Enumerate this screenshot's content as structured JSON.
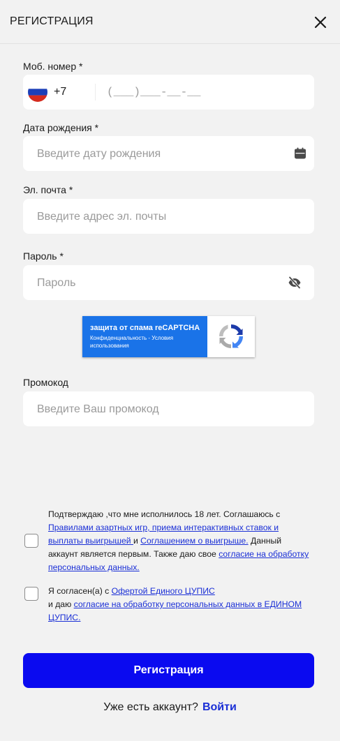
{
  "header": {
    "title": "РЕГИСТРАЦИЯ"
  },
  "icons": {
    "close": "close-icon",
    "flag": "russia-flag-icon",
    "calendar": "calendar-icon",
    "eye": "eye-off-icon",
    "recaptcha": "recaptcha-logo"
  },
  "phone": {
    "label": "Моб. номер *",
    "code": "+7",
    "mask": "(___)___-__-__"
  },
  "birthdate": {
    "label": "Дата рождения *",
    "placeholder": "Введите дату рождения"
  },
  "email": {
    "label": "Эл. почта *",
    "placeholder": "Введите адрес эл. почты"
  },
  "password": {
    "label": "Пароль *",
    "placeholder": "Пароль"
  },
  "recaptcha": {
    "title": "защита от спама reCAPTCHA",
    "privacy": "Конфиденциальность",
    "separator": " - ",
    "terms": "Условия использования"
  },
  "promo": {
    "label": "Промокод",
    "placeholder": "Введите Ваш промокод"
  },
  "consent1": {
    "t1": "Подтверждаю ,что мне исполнилось 18 лет. Соглашаюсь с ",
    "l1": "Правилами азартных игр, приема интерактивных ставок и выплаты выигрышей ",
    "t2": "и ",
    "l2": "Соглашением о выигрыше.",
    "t3": " Данный аккаунт является первым. Также даю свое ",
    "l3": "согласие на обработку персональных данных."
  },
  "consent2": {
    "t1": "Я согласен(а) с ",
    "l1": "Офертой Единого ЦУПИС",
    "t2": " и даю ",
    "l2": "согласие на обработку персональных данных в ЕДИНОМ ЦУПИС."
  },
  "submit": {
    "label": "Регистрация"
  },
  "login": {
    "text": "Уже есть аккаунт?",
    "link": "Войти"
  },
  "colors": {
    "accent": "#0a0af0",
    "link": "#1a2fd6",
    "recaptcha_blue": "#1a73e8",
    "background": "#f2f2f2"
  }
}
